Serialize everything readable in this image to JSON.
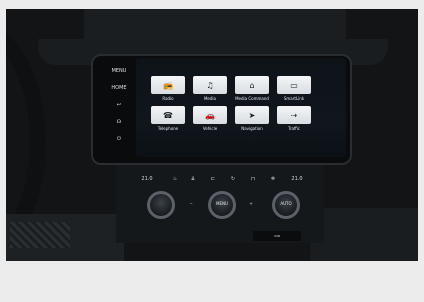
{
  "side_buttons": [
    "MENU",
    "HOME",
    "↩",
    "☊",
    "⏻"
  ],
  "tiles_row1": [
    {
      "label": "Radio",
      "icon": "radio-icon"
    },
    {
      "label": "Media",
      "icon": "music-icon"
    },
    {
      "label": "Media Command",
      "icon": "media-command-icon"
    },
    {
      "label": "SmartLink",
      "icon": "smartlink-icon"
    }
  ],
  "tiles_row2": [
    {
      "label": "Telephone",
      "icon": "phone-icon"
    },
    {
      "label": "Vehicle",
      "icon": "car-icon"
    },
    {
      "label": "Navigation",
      "icon": "navigation-icon"
    },
    {
      "label": "Traffic",
      "icon": "traffic-icon"
    }
  ],
  "climate_left_temp": "21.0",
  "climate_right_temp": "21.0",
  "knob_left_label": "",
  "knob_center_label": "MENU",
  "knob_right_label": "AUTO",
  "port_text": "USB"
}
